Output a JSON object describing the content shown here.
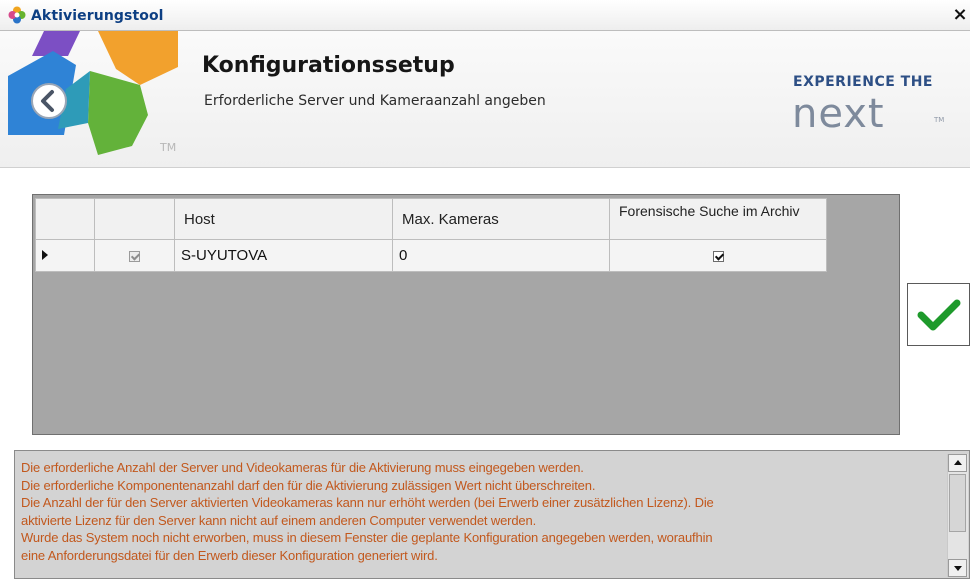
{
  "window": {
    "title": "Aktivierungstool",
    "close_label": "×"
  },
  "header": {
    "title": "Konfigurationssetup",
    "subtitle": "Erforderliche Server und Kameraanzahl angeben",
    "tm": "TM",
    "brand_top": "EXPERIENCE THE",
    "brand_word": "next",
    "brand_tm": "TM"
  },
  "grid": {
    "columns": [
      "",
      "",
      "Host",
      "Max. Kameras",
      "Forensische Suche im Archiv"
    ],
    "rows": [
      {
        "enabled": true,
        "host": "S-UYUTOVA",
        "max_cameras": "0",
        "forensic_search": true
      }
    ]
  },
  "info": {
    "lines": [
      "Die erforderliche Anzahl der Server und Videokameras für die Aktivierung muss eingegeben werden.",
      "Die erforderliche Komponentenanzahl darf den für die Aktivierung zulässigen Wert nicht überschreiten.",
      "Die Anzahl der für den Server aktivierten Videokameras kann nur erhöht werden (bei Erwerb einer zusätzlichen Lizenz). Die",
      "aktivierte Lizenz für den Server kann nicht auf einem anderen Computer verwendet werden.",
      "Wurde das System noch nicht erworben, muss in diesem Fenster die geplante Konfiguration angegeben werden, woraufhin",
      "eine Anforderungsdatei für den Erwerb dieser Konfiguration generiert wird."
    ]
  },
  "colors": {
    "title": "#0d3f83",
    "info_text": "#c2581d",
    "check_green": "#1e9a2b",
    "brand_blue": "#2d4f85",
    "brand_grey": "#7e8a9c"
  },
  "icons": {
    "app": "flower-app-icon",
    "back": "back-arrow-icon",
    "apply": "checkmark-icon"
  }
}
